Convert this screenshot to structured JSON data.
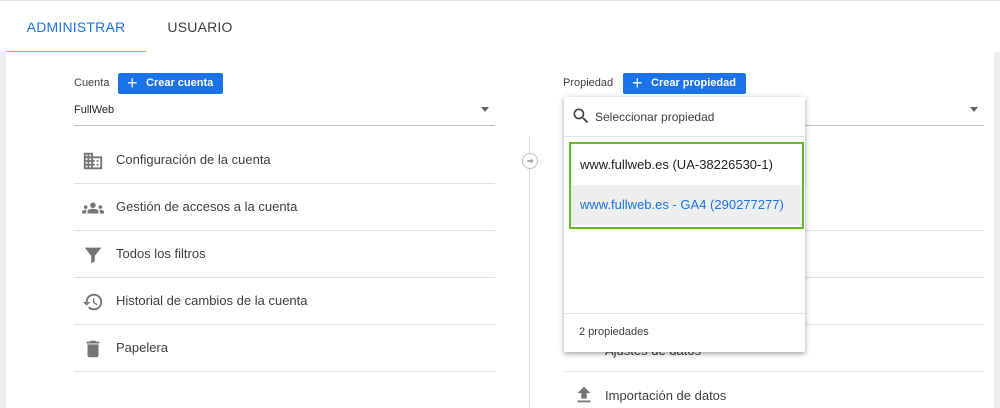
{
  "tabs": {
    "admin": "ADMINISTRAR",
    "user": "USUARIO"
  },
  "account": {
    "label": "Cuenta",
    "create_button": "Crear cuenta",
    "selected": "FullWeb"
  },
  "account_menu": [
    {
      "label": "Configuración de la cuenta",
      "icon": "building-icon"
    },
    {
      "label": "Gestión de accesos a la cuenta",
      "icon": "people-icon"
    },
    {
      "label": "Todos los filtros",
      "icon": "filter-icon"
    },
    {
      "label": "Historial de cambios de la cuenta",
      "icon": "history-icon"
    },
    {
      "label": "Papelera",
      "icon": "trash-icon"
    }
  ],
  "property": {
    "label": "Propiedad",
    "create_button": "Crear propiedad"
  },
  "property_menu_visible": {
    "partial_label": "Ajustes de datos",
    "import_label": "Importación de datos"
  },
  "property_dropdown": {
    "search_placeholder": "Seleccionar propiedad",
    "items": [
      "www.fullweb.es (UA-38226530-1)",
      "www.fullweb.es - GA4 (290277277)"
    ],
    "footer": "2 propiedades",
    "highlight_color": "#66bb22"
  },
  "colors": {
    "accent": "#1a73e8",
    "tab_ink": "#f29900"
  }
}
